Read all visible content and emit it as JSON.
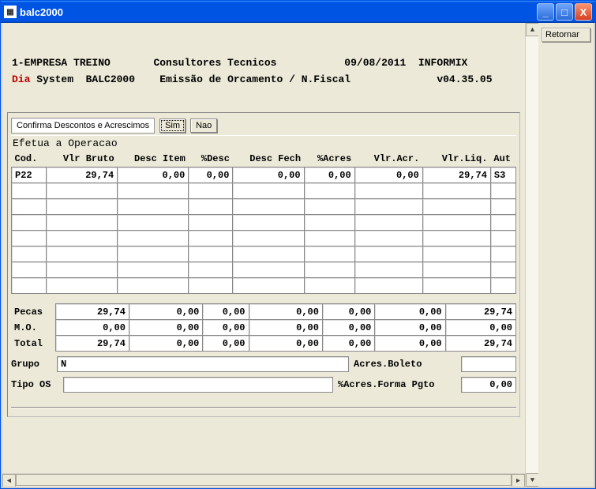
{
  "window": {
    "title": "balc2000"
  },
  "side": {
    "retornar": "Retornar"
  },
  "header": {
    "company": "1-EMPRESA TREINO",
    "consultores": "Consultores Tecnicos",
    "date": "09/08/2011",
    "db": "INFORMIX",
    "dia": "Dia",
    "system": "System  BALC2000",
    "emissao": "Emissão de Orcamento / N.Fiscal",
    "version": "v04.35.05"
  },
  "confirm": {
    "label": "Confirma Descontos e Acrescimos",
    "sim": "Sim",
    "nao": "Nao",
    "efetua": "Efetua a Operacao"
  },
  "columns": {
    "cod": "Cod.",
    "vlr_bruto": "Vlr Bruto",
    "desc_item": "Desc Item",
    "pct_desc": "%Desc",
    "desc_fech": "Desc Fech",
    "pct_acres": "%Acres",
    "vlr_acr": "Vlr.Acr.",
    "vlr_liq": "Vlr.Liq.",
    "aut": "Aut"
  },
  "rows": [
    {
      "cod": "P22",
      "vlr_bruto": "29,74",
      "desc_item": "0,00",
      "pct_desc": "0,00",
      "desc_fech": "0,00",
      "pct_acres": "0,00",
      "vlr_acr": "0,00",
      "vlr_liq": "29,74",
      "aut": "S3"
    },
    {
      "cod": "",
      "vlr_bruto": "",
      "desc_item": "",
      "pct_desc": "",
      "desc_fech": "",
      "pct_acres": "",
      "vlr_acr": "",
      "vlr_liq": "",
      "aut": ""
    },
    {
      "cod": "",
      "vlr_bruto": "",
      "desc_item": "",
      "pct_desc": "",
      "desc_fech": "",
      "pct_acres": "",
      "vlr_acr": "",
      "vlr_liq": "",
      "aut": ""
    },
    {
      "cod": "",
      "vlr_bruto": "",
      "desc_item": "",
      "pct_desc": "",
      "desc_fech": "",
      "pct_acres": "",
      "vlr_acr": "",
      "vlr_liq": "",
      "aut": ""
    },
    {
      "cod": "",
      "vlr_bruto": "",
      "desc_item": "",
      "pct_desc": "",
      "desc_fech": "",
      "pct_acres": "",
      "vlr_acr": "",
      "vlr_liq": "",
      "aut": ""
    },
    {
      "cod": "",
      "vlr_bruto": "",
      "desc_item": "",
      "pct_desc": "",
      "desc_fech": "",
      "pct_acres": "",
      "vlr_acr": "",
      "vlr_liq": "",
      "aut": ""
    },
    {
      "cod": "",
      "vlr_bruto": "",
      "desc_item": "",
      "pct_desc": "",
      "desc_fech": "",
      "pct_acres": "",
      "vlr_acr": "",
      "vlr_liq": "",
      "aut": ""
    },
    {
      "cod": "",
      "vlr_bruto": "",
      "desc_item": "",
      "pct_desc": "",
      "desc_fech": "",
      "pct_acres": "",
      "vlr_acr": "",
      "vlr_liq": "",
      "aut": ""
    }
  ],
  "summary": {
    "labels": {
      "pecas": "Pecas",
      "mo": "M.O.",
      "total": "Total"
    },
    "pecas": {
      "vlr_bruto": "29,74",
      "desc_item": "0,00",
      "pct_desc": "0,00",
      "desc_fech": "0,00",
      "pct_acres": "0,00",
      "vlr_acr": "0,00",
      "vlr_liq": "29,74"
    },
    "mo": {
      "vlr_bruto": "0,00",
      "desc_item": "0,00",
      "pct_desc": "0,00",
      "desc_fech": "0,00",
      "pct_acres": "0,00",
      "vlr_acr": "0,00",
      "vlr_liq": "0,00"
    },
    "total": {
      "vlr_bruto": "29,74",
      "desc_item": "0,00",
      "pct_desc": "0,00",
      "desc_fech": "0,00",
      "pct_acres": "0,00",
      "vlr_acr": "0,00",
      "vlr_liq": "29,74"
    }
  },
  "footer": {
    "grupo_label": "Grupo",
    "grupo_value": "N",
    "acres_boleto_label": "Acres.Boleto",
    "acres_boleto_value": "",
    "tipo_os_label": "Tipo OS",
    "tipo_os_value": "",
    "pct_acres_pgto_label": "%Acres.Forma Pgto",
    "pct_acres_pgto_value": "0,00"
  }
}
